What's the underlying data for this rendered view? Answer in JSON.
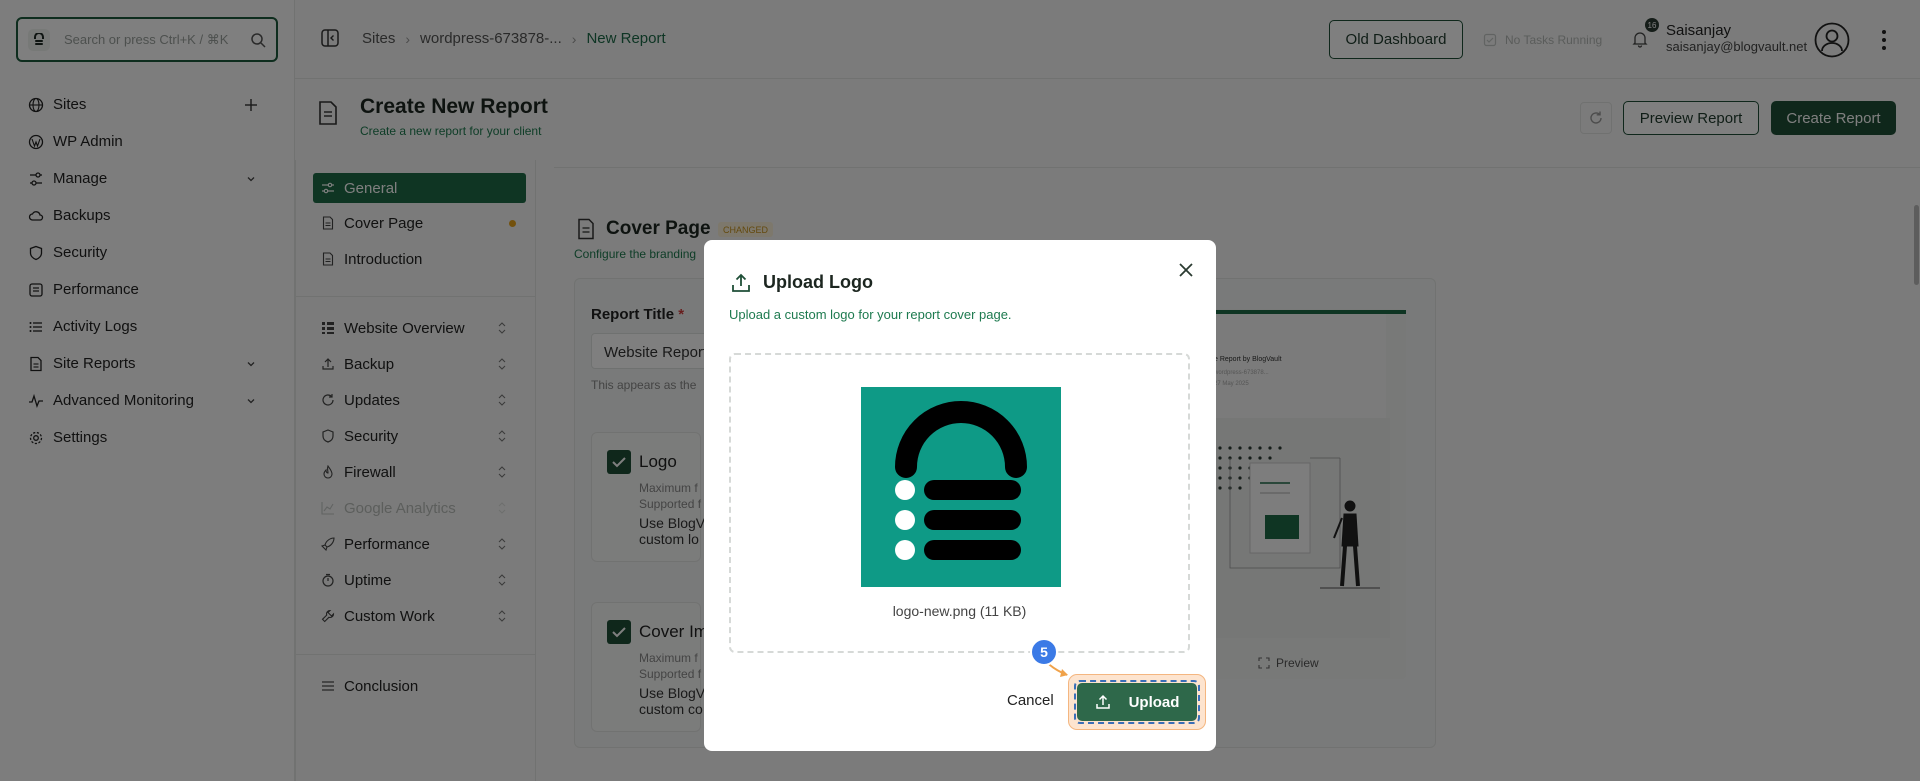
{
  "search": {
    "placeholder": "Search or press Ctrl+K / ⌘K"
  },
  "sidebar": {
    "items": [
      {
        "label": "Sites",
        "icon": "globe-icon",
        "tail": "plus"
      },
      {
        "label": "WP Admin",
        "icon": "wordpress-icon",
        "tail": ""
      },
      {
        "label": "Manage",
        "icon": "sliders-icon",
        "tail": "chevron"
      },
      {
        "label": "Backups",
        "icon": "cloud-icon",
        "tail": ""
      },
      {
        "label": "Security",
        "icon": "shield-icon",
        "tail": ""
      },
      {
        "label": "Performance",
        "icon": "gauge-icon",
        "tail": ""
      },
      {
        "label": "Activity Logs",
        "icon": "list-icon",
        "tail": ""
      },
      {
        "label": "Site Reports",
        "icon": "report-icon",
        "tail": "chevron"
      },
      {
        "label": "Advanced Monitoring",
        "icon": "pulse-icon",
        "tail": "chevron"
      },
      {
        "label": "Settings",
        "icon": "gear-icon",
        "tail": ""
      }
    ]
  },
  "breadcrumb": [
    "Sites",
    "wordpress-673878-...",
    "New Report"
  ],
  "topbar": {
    "old_dashboard": "Old Dashboard",
    "tasks": "No Tasks Running",
    "notif_count": "16",
    "user_name": "Saisanjay",
    "user_email": "saisanjay@blogvault.net"
  },
  "page": {
    "title": "Create New Report",
    "subtitle": "Create a new report for your client",
    "preview_label": "Preview Report",
    "create_label": "Create Report"
  },
  "secnav": {
    "top": [
      {
        "label": "General",
        "active": true,
        "dot": false
      },
      {
        "label": "Cover Page",
        "active": false,
        "dot": true
      },
      {
        "label": "Introduction",
        "active": false,
        "dot": false
      }
    ],
    "modules": [
      {
        "label": "Website Overview",
        "disabled": false
      },
      {
        "label": "Backup",
        "disabled": false
      },
      {
        "label": "Updates",
        "disabled": false
      },
      {
        "label": "Security",
        "disabled": false
      },
      {
        "label": "Firewall",
        "disabled": false
      },
      {
        "label": "Google Analytics",
        "disabled": true
      },
      {
        "label": "Performance",
        "disabled": false
      },
      {
        "label": "Uptime",
        "disabled": false
      },
      {
        "label": "Custom Work",
        "disabled": false
      }
    ],
    "bottom": "Conclusion"
  },
  "cover": {
    "title": "Cover Page",
    "badge": "CHANGED",
    "subtitle": "Configure the branding",
    "report_title_label": "Report Title",
    "report_title_required": "*",
    "report_title_value": "Website Report",
    "report_title_hint": "This appears as the",
    "logo": {
      "title": "Logo",
      "line1": "Maximum f",
      "line2": "Supported f",
      "line3": "Use BlogV",
      "line4": "custom lo"
    },
    "cover_image": {
      "title": "Cover Im",
      "line1": "Maximum f",
      "line2": "Supported f",
      "line3": "Use BlogV",
      "line4": "custom co"
    },
    "preview_heading": "e Report by BlogVault",
    "preview_line1": "wordpress-673878...",
    "preview_line2": "27 May 2025",
    "preview_link": "Preview"
  },
  "modal": {
    "title": "Upload Logo",
    "subtitle": "Upload a custom logo for your report cover page.",
    "file_name": "logo-new.png (11 KB)",
    "cancel_label": "Cancel",
    "upload_label": "Upload",
    "step_number": "5",
    "logo_color": "#0e9a86"
  },
  "colors": {
    "brand": "#1f4f37",
    "accent": "#1d7a4f",
    "step": "#3b7ae6",
    "highlight": "#fde4cf"
  }
}
